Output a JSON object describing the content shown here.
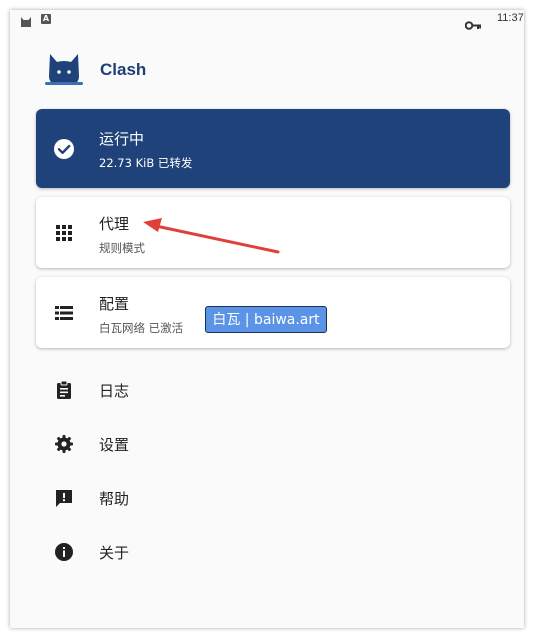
{
  "status_bar": {
    "time": "11:37",
    "icons": [
      "clash-cat-icon",
      "a-notification-icon",
      "vpn-key-icon"
    ]
  },
  "app": {
    "title": "Clash",
    "accent_color": "#1e4279"
  },
  "status_card": {
    "title": "运行中",
    "subtitle": "22.73 KiB 已转发",
    "icon": "check-circle-icon"
  },
  "proxy_card": {
    "title": "代理",
    "subtitle": "规则模式",
    "icon": "grid-icon"
  },
  "config_card": {
    "title": "配置",
    "subtitle": "白瓦网络 已激活",
    "icon": "list-icon"
  },
  "watermark": {
    "text": "白瓦 | baiwa.art"
  },
  "menu": {
    "items": [
      {
        "label": "日志",
        "icon": "clipboard-icon"
      },
      {
        "label": "设置",
        "icon": "gear-icon"
      },
      {
        "label": "帮助",
        "icon": "feedback-icon"
      },
      {
        "label": "关于",
        "icon": "info-icon"
      }
    ]
  }
}
